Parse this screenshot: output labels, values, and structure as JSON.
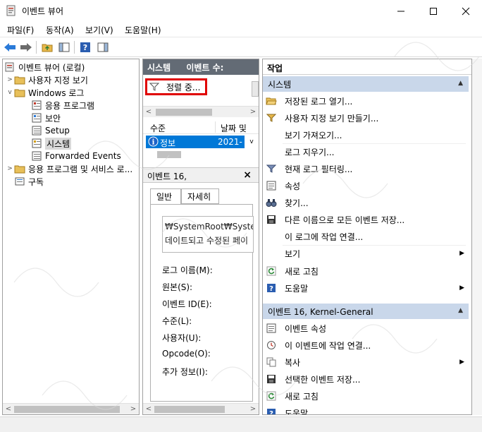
{
  "window": {
    "title": "이벤트 뷰어",
    "icon": "event-viewer-icon"
  },
  "menu": {
    "file": "파일(F)",
    "action": "동작(A)",
    "view": "보기(V)",
    "help": "도움말(H)"
  },
  "tree": {
    "root": "이벤트 뷰어 (로컬)",
    "custom_views": "사용자 지정 보기",
    "windows_logs": "Windows 로그",
    "application": "응용 프로그램",
    "security": "보안",
    "setup": "Setup",
    "system": "시스템",
    "forwarded": "Forwarded Events",
    "app_services": "응용 프로그램 및 서비스 로...",
    "subscriptions": "구독"
  },
  "middle": {
    "header_log": "시스템",
    "header_count": "이벤트 수:",
    "filter_label": "정렬 중...",
    "col_level": "수준",
    "col_date": "날짜 및",
    "row_level": "정보",
    "row_date": "2021-",
    "detail_title": "이벤트 16,",
    "tab_general": "일반",
    "tab_details": "자세히",
    "desc_line1": "₩SystemRoot₩System",
    "desc_line2": "데이트되고 수정된 페이",
    "fields": {
      "log_name": "로그 이름(M):",
      "source": "원본(S):",
      "event_id": "이벤트 ID(E):",
      "level": "수준(L):",
      "user": "사용자(U):",
      "opcode": "Opcode(O):",
      "more_info": "추가 정보(I):"
    }
  },
  "actions": {
    "title": "작업",
    "section1": "시스템",
    "items1": [
      "저장된 로그 열기...",
      "사용자 지정 보기 만들기...",
      "보기 가져오기...",
      "로그 지우기...",
      "현재 로그 필터링...",
      "속성",
      "찾기...",
      "다른 이름으로 모든 이벤트 저장...",
      "이 로그에 작업 연결...",
      "보기",
      "새로 고침",
      "도움말"
    ],
    "section2": "이벤트 16, Kernel-General",
    "items2": [
      "이벤트 속성",
      "이 이벤트에 작업 연결...",
      "복사",
      "선택한 이벤트 저장...",
      "새로 고침",
      "도움말"
    ]
  },
  "colors": {
    "selection": "#0078d7",
    "section_header": "#c9d7ea",
    "middle_header": "#636b75",
    "highlight_box": "#e00000"
  }
}
